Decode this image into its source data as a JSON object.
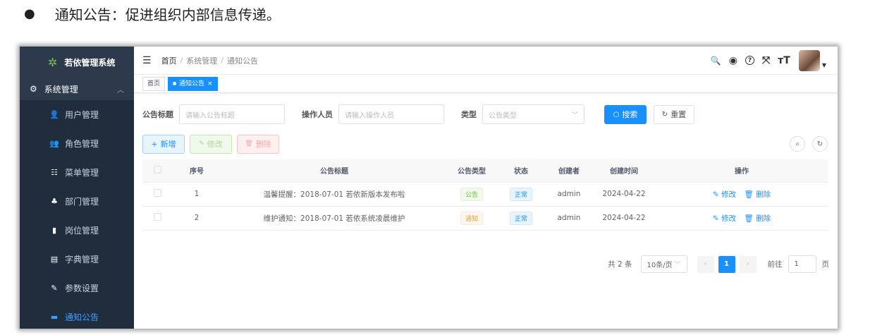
{
  "doc": {
    "bullet": "●",
    "text": "通知公告：促进组织内部信息传递。"
  },
  "sidebar": {
    "logo": "若依管理系统",
    "parent": "系统管理",
    "items": [
      {
        "label": "用户管理",
        "icon": "user-icon",
        "glyph": "👤"
      },
      {
        "label": "角色管理",
        "icon": "role-icon",
        "glyph": "👥"
      },
      {
        "label": "菜单管理",
        "icon": "menu-tree-icon",
        "glyph": "☷"
      },
      {
        "label": "部门管理",
        "icon": "dept-tree-icon",
        "glyph": "♣"
      },
      {
        "label": "岗位管理",
        "icon": "post-icon",
        "glyph": "▮"
      },
      {
        "label": "字典管理",
        "icon": "dict-icon",
        "glyph": "▤"
      },
      {
        "label": "参数设置",
        "icon": "edit-icon",
        "glyph": "✎"
      },
      {
        "label": "通知公告",
        "icon": "message-icon",
        "glyph": "▬"
      }
    ]
  },
  "navbar": {
    "breadcrumb": [
      "首页",
      "系统管理",
      "通知公告"
    ],
    "sep": "/",
    "icons": [
      {
        "name": "search-icon",
        "glyph": "🔍"
      },
      {
        "name": "github-icon",
        "glyph": "◉"
      },
      {
        "name": "help-icon",
        "glyph": "?"
      },
      {
        "name": "fullscreen-icon",
        "glyph": "⤧"
      },
      {
        "name": "font-size-icon",
        "glyph": "ᴛT"
      }
    ]
  },
  "tags": {
    "home": "首页",
    "current": "通知公告",
    "close": "×"
  },
  "search": {
    "title_label": "公告标题",
    "title_placeholder": "请输入公告标题",
    "operator_label": "操作人员",
    "operator_placeholder": "请输入操作人员",
    "type_label": "类型",
    "type_placeholder": "公告类型",
    "search_btn": "搜索",
    "reset_btn": "重置"
  },
  "toolbar": {
    "add": "新增",
    "edit": "修改",
    "delete": "删除"
  },
  "table": {
    "headers": [
      "序号",
      "公告标题",
      "公告类型",
      "状态",
      "创建者",
      "创建时间",
      "操作"
    ],
    "rows": [
      {
        "no": "1",
        "title": "温馨提醒：2018-07-01 若依新版本发布啦",
        "type": "公告",
        "status": "正常",
        "creator": "admin",
        "time": "2024-04-22",
        "edit": "修改",
        "del": "删除"
      },
      {
        "no": "2",
        "title": "维护通知：2018-07-01 若依系统凌晨维护",
        "type": "通知",
        "status": "正常",
        "creator": "admin",
        "time": "2024-04-22",
        "edit": "修改",
        "del": "删除"
      }
    ]
  },
  "pager": {
    "total": "共 2 条",
    "size": "10条/页",
    "page": "1",
    "goto": "前往",
    "goto_value": "1",
    "page_unit": "页"
  }
}
